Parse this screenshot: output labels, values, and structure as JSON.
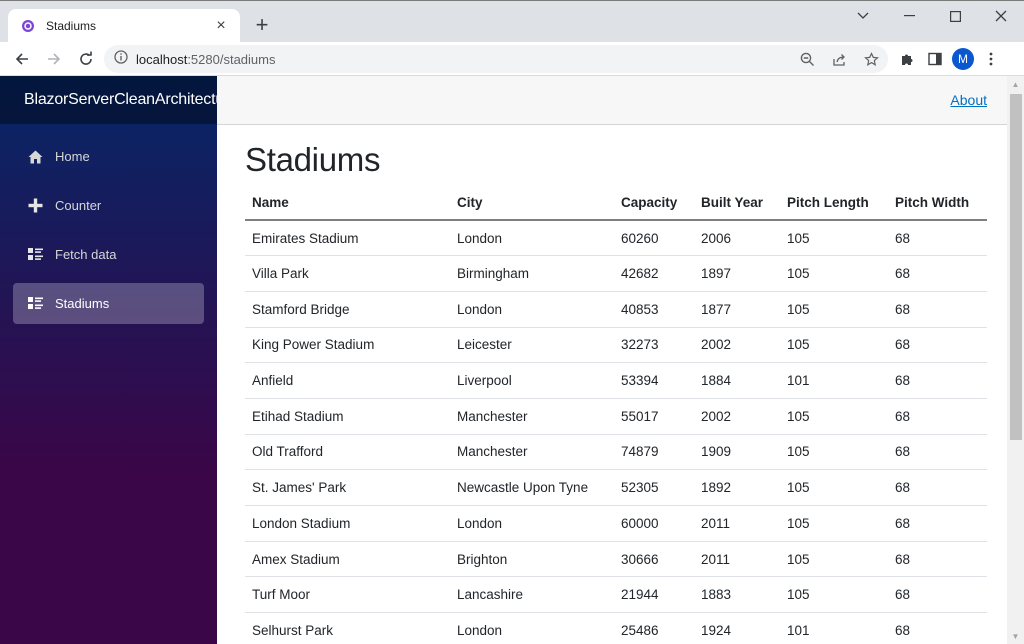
{
  "browser": {
    "tab_title": "Stadiums",
    "tab_close": "×",
    "new_tab": "+",
    "url_host": "localhost",
    "url_path": ":5280/stadiums",
    "profile_initial": "M",
    "window_controls": {
      "menu": "⌄",
      "minimize": "—",
      "maximize": "☐",
      "close": "✕"
    }
  },
  "sidebar": {
    "brand": "BlazorServerCleanArchitecture",
    "items": [
      {
        "label": "Home",
        "icon": "home-icon",
        "active": false
      },
      {
        "label": "Counter",
        "icon": "plus-icon",
        "active": false
      },
      {
        "label": "Fetch data",
        "icon": "list-rich-icon",
        "active": false
      },
      {
        "label": "Stadiums",
        "icon": "list-rich-icon",
        "active": true
      }
    ]
  },
  "header": {
    "about_label": "About"
  },
  "main": {
    "title": "Stadiums",
    "table": {
      "columns": [
        "Name",
        "City",
        "Capacity",
        "Built Year",
        "Pitch Length",
        "Pitch Width"
      ],
      "rows": [
        [
          "Emirates Stadium",
          "London",
          "60260",
          "2006",
          "105",
          "68"
        ],
        [
          "Villa Park",
          "Birmingham",
          "42682",
          "1897",
          "105",
          "68"
        ],
        [
          "Stamford Bridge",
          "London",
          "40853",
          "1877",
          "105",
          "68"
        ],
        [
          "King Power Stadium",
          "Leicester",
          "32273",
          "2002",
          "105",
          "68"
        ],
        [
          "Anfield",
          "Liverpool",
          "53394",
          "1884",
          "101",
          "68"
        ],
        [
          "Etihad Stadium",
          "Manchester",
          "55017",
          "2002",
          "105",
          "68"
        ],
        [
          "Old Trafford",
          "Manchester",
          "74879",
          "1909",
          "105",
          "68"
        ],
        [
          "St. James' Park",
          "Newcastle Upon Tyne",
          "52305",
          "1892",
          "105",
          "68"
        ],
        [
          "London Stadium",
          "London",
          "60000",
          "2011",
          "105",
          "68"
        ],
        [
          "Amex Stadium",
          "Brighton",
          "30666",
          "2011",
          "105",
          "68"
        ],
        [
          "Turf Moor",
          "Lancashire",
          "21944",
          "1883",
          "105",
          "68"
        ],
        [
          "Selhurst Park",
          "London",
          "25486",
          "1924",
          "101",
          "68"
        ]
      ]
    }
  },
  "colors": {
    "sidebar_top": "#052767",
    "sidebar_bottom": "#3a0647",
    "link": "#0071c1",
    "avatar": "#0b57d0"
  }
}
